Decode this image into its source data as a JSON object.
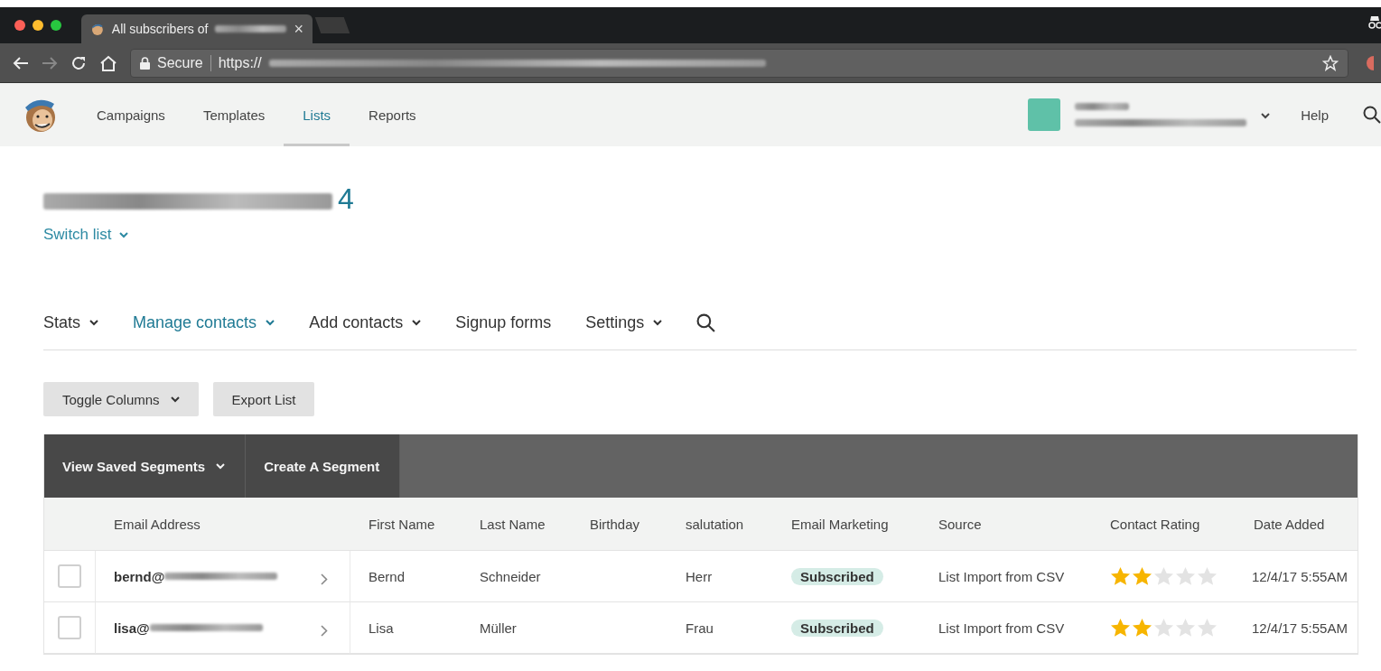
{
  "browser": {
    "tab_title": "All subscribers of",
    "tab_close": "×",
    "address_security": "Secure",
    "address_url": "https://"
  },
  "nav": {
    "items": [
      {
        "label": "Campaigns",
        "selected": false
      },
      {
        "label": "Templates",
        "selected": false
      },
      {
        "label": "Lists",
        "selected": true
      },
      {
        "label": "Reports",
        "selected": false
      }
    ],
    "help": "Help"
  },
  "list_header": {
    "count": "4",
    "switch_list": "Switch list"
  },
  "sub_nav": {
    "items": [
      {
        "label": "Stats",
        "selected": false,
        "dropdown": true
      },
      {
        "label": "Manage contacts",
        "selected": true,
        "dropdown": true
      },
      {
        "label": "Add contacts",
        "selected": false,
        "dropdown": true
      },
      {
        "label": "Signup forms",
        "selected": false,
        "dropdown": false
      },
      {
        "label": "Settings",
        "selected": false,
        "dropdown": true
      }
    ]
  },
  "buttons": [
    {
      "label": "Toggle Columns",
      "dropdown": true
    },
    {
      "label": "Export List",
      "dropdown": false
    }
  ],
  "segment_bar": [
    {
      "label": "View Saved Segments",
      "dropdown": true
    },
    {
      "label": "Create A Segment",
      "dropdown": false
    }
  ],
  "table": {
    "columns": [
      "Email Address",
      "First Name",
      "Last Name",
      "Birthday",
      "salutation",
      "Email Marketing",
      "Source",
      "Contact Rating",
      "Date Added"
    ],
    "rows": [
      {
        "checked": false,
        "email": "bernd@",
        "first_name": "Bernd",
        "last_name": "Schneider",
        "salutation": "Herr",
        "email_marketing": "Subscribed",
        "source": "List Import from CSV",
        "stars": 2,
        "date_added": "12/4/17 5:55AM"
      },
      {
        "checked": false,
        "email": "lisa@",
        "first_name": "Lisa",
        "last_name": "Müller",
        "salutation": "Frau",
        "email_marketing": "Subscribed",
        "source": "List Import from CSV",
        "stars": 2,
        "date_added": "12/4/17 5:55AM"
      }
    ]
  }
}
